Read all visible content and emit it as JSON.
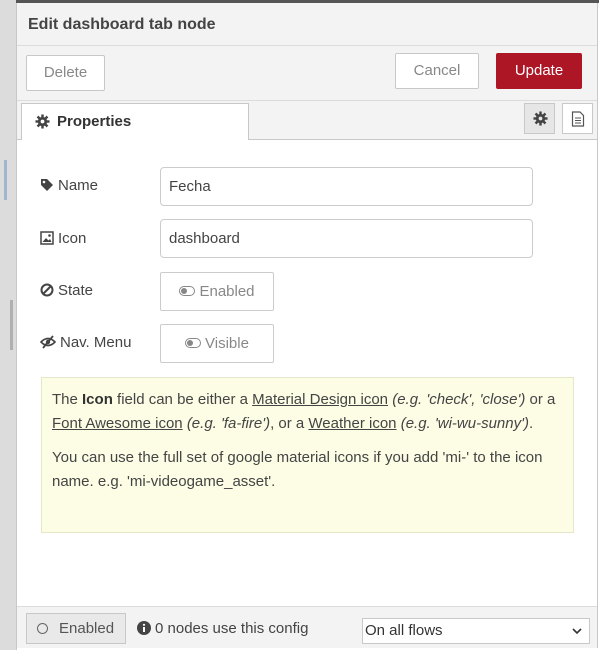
{
  "dialog": {
    "title": "Edit dashboard tab node"
  },
  "actions": {
    "delete_label": "Delete",
    "cancel_label": "Cancel",
    "update_label": "Update",
    "update_color": "#ad1625"
  },
  "tabs": {
    "properties_label": "Properties",
    "settings_icon": "gear-icon",
    "description_icon": "document-icon"
  },
  "form": {
    "name": {
      "label": "Name",
      "icon": "tag-icon",
      "value": "Fecha"
    },
    "icon": {
      "label": "Icon",
      "icon": "image-icon",
      "value": "dashboard"
    },
    "state": {
      "label": "State",
      "icon": "ban-icon",
      "toggle_label": "Enabled"
    },
    "nav_menu": {
      "label": "Nav. Menu",
      "icon": "eye-slash-icon",
      "toggle_label": "Visible"
    }
  },
  "help": {
    "p1": {
      "t1": "The ",
      "icon_word": "Icon",
      "t2": " field can be either a ",
      "link_material": "Material Design icon",
      "ex_material": "(e.g. 'check', 'close')",
      "t3": " or a ",
      "link_fa": "Font Awesome icon",
      "ex_fa": "(e.g. 'fa-fire')",
      "t4": ", or a ",
      "link_weather": "Weather icon",
      "ex_weather": "(e.g. 'wi-wu-sunny')",
      "t5": "."
    },
    "p2": "You can use the full set of google material icons if you add 'mi-' to the icon name. e.g. 'mi-videogame_asset'."
  },
  "footer": {
    "enabled_label": "Enabled",
    "usage_text": "0 nodes use this config",
    "scope_value": "On all flows"
  }
}
